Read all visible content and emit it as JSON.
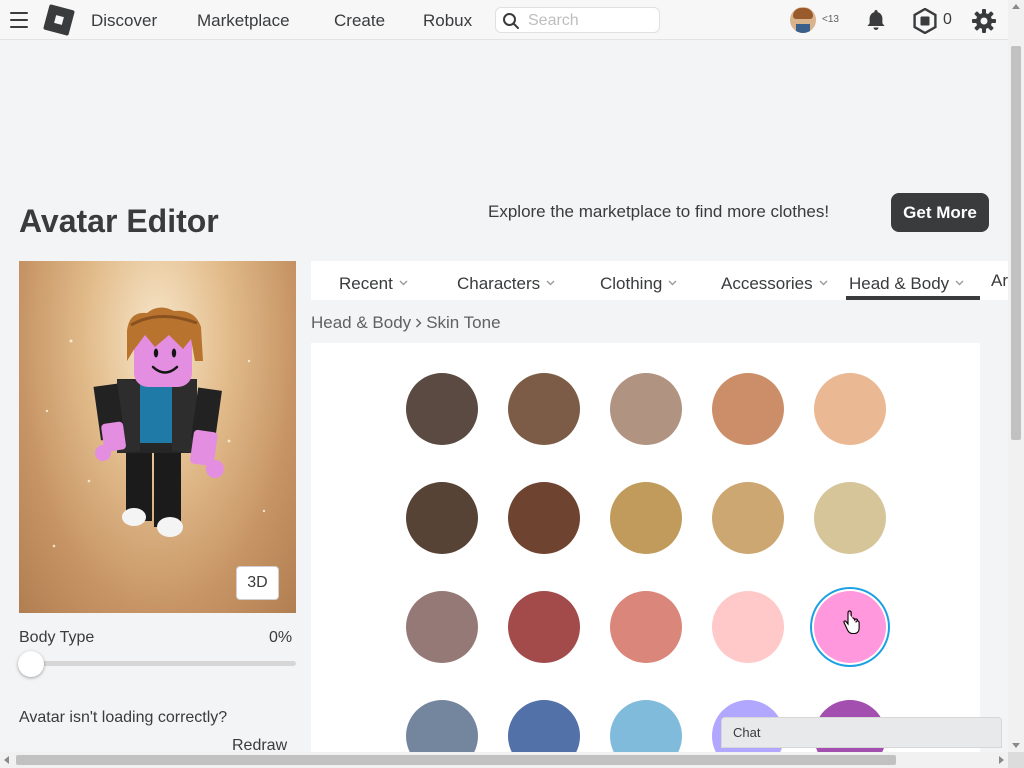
{
  "nav": {
    "links": [
      "Discover",
      "Marketplace",
      "Create",
      "Robux"
    ],
    "search_placeholder": "Search",
    "age_badge": "<13",
    "robux_count": "0"
  },
  "header": {
    "title": "Avatar Editor",
    "explore_text": "Explore the marketplace to find more clothes!",
    "get_more_label": "Get More"
  },
  "preview": {
    "view_toggle": "3D",
    "body_type_label": "Body Type",
    "body_type_value": "0%",
    "body_type_fraction": 0,
    "issue_text": "Avatar isn't loading correctly?",
    "redraw_label": "Redraw"
  },
  "tabs": [
    {
      "label": "Recent",
      "active": false
    },
    {
      "label": "Characters",
      "active": false
    },
    {
      "label": "Clothing",
      "active": false
    },
    {
      "label": "Accessories",
      "active": false
    },
    {
      "label": "Head & Body",
      "active": true
    },
    {
      "label": "Ar",
      "active": false
    }
  ],
  "breadcrumb": {
    "parent": "Head & Body",
    "current": "Skin Tone"
  },
  "skin_tones": [
    [
      "#5a4a42",
      "#7c5c46",
      "#b09380",
      "#cc8e69",
      "#eab892"
    ],
    [
      "#574236",
      "#6e4330",
      "#c09b5c",
      "#cca771",
      "#d7c59a"
    ],
    [
      "#957977",
      "#a34b4b",
      "#da867a",
      "#ffc9c9",
      "#ff98dc"
    ],
    [
      "#74869d",
      "#5171a8",
      "#80bbdb",
      "#b1a7ff",
      "#a34faf"
    ]
  ],
  "selected_tone": {
    "row": 2,
    "col": 4
  },
  "chat": {
    "label": "Chat"
  },
  "colors": {
    "accent_selected": "#1aa0e3",
    "dark": "#393b3d"
  }
}
